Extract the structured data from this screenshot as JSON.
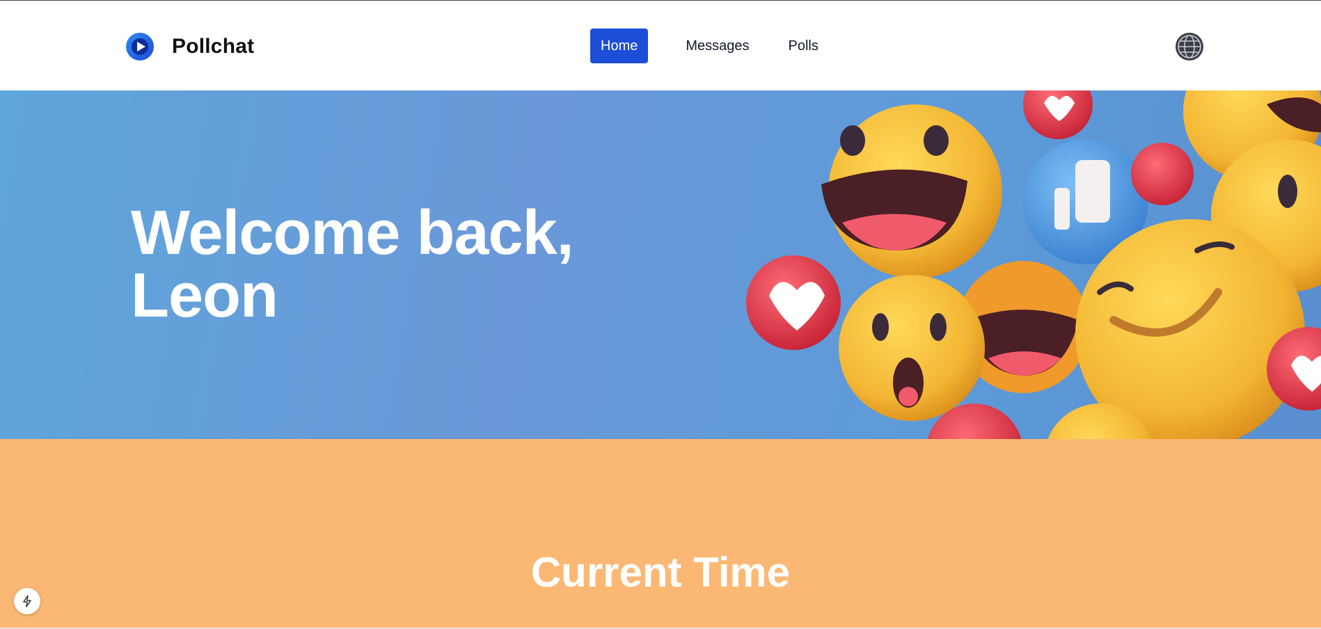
{
  "header": {
    "brand_name": "Pollchat",
    "logo_icon": "play-logo-icon",
    "nav": [
      {
        "label": "Home",
        "active": true
      },
      {
        "label": "Messages",
        "active": false
      },
      {
        "label": "Polls",
        "active": false
      }
    ],
    "language_icon": "globe-icon",
    "accent_color": "#1d4ed8"
  },
  "hero": {
    "title_line1": "Welcome back,",
    "title_line2": "Leon",
    "image_icon": "emoji-reactions-illustration"
  },
  "time_section": {
    "title": "Current Time",
    "background_color": "#fbb874"
  },
  "badge": {
    "icon": "lightning-icon"
  }
}
